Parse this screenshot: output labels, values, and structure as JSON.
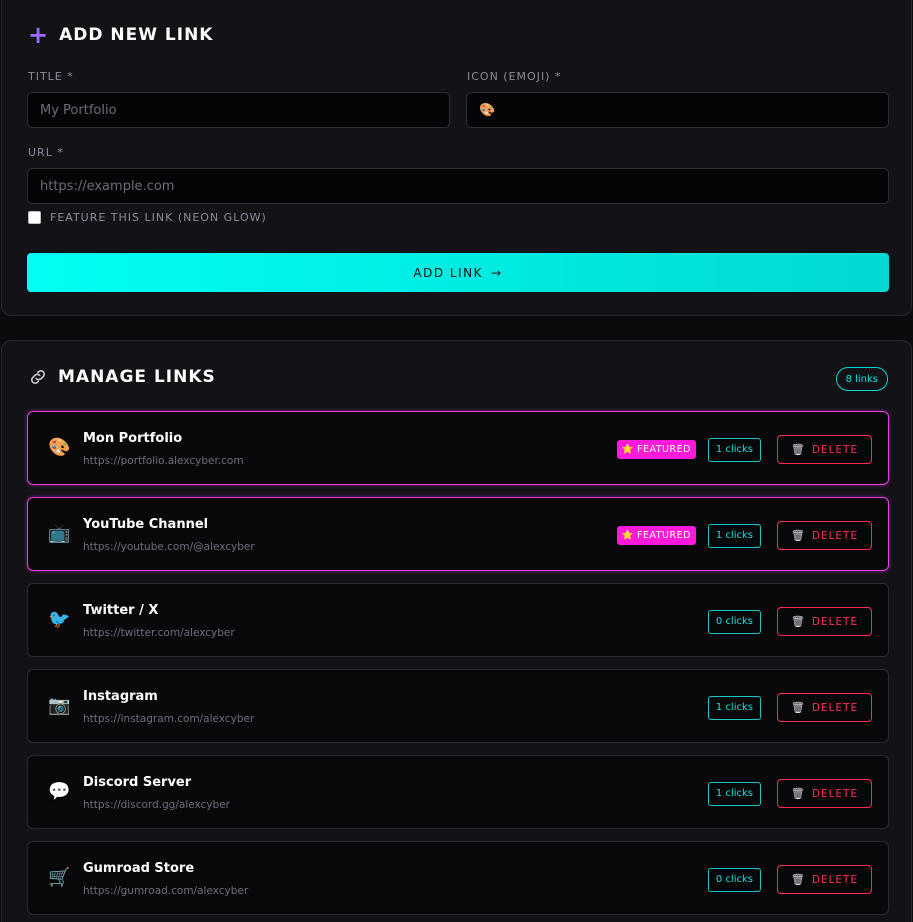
{
  "add_form": {
    "title": "ADD NEW LINK",
    "title_icon": "plus-icon",
    "title_label": "TITLE *",
    "title_placeholder": "My Portfolio",
    "icon_label": "ICON (EMOJI) *",
    "icon_value": "🎨",
    "url_label": "URL *",
    "url_placeholder": "https://example.com",
    "feature_label": "FEATURE THIS LINK (NEON GLOW)",
    "feature_checked": false,
    "submit_label": "ADD LINK",
    "submit_arrow": "→"
  },
  "manage": {
    "title": "MANAGE LINKS",
    "title_icon": "link-icon",
    "count_badge": "8 links",
    "featured_label": "FEATURED",
    "featured_star": "⭐",
    "delete_label": "DELETE",
    "delete_icon": "🗑",
    "links": [
      {
        "emoji": "🎨",
        "title": "Mon Portfolio",
        "url": "https://portfolio.alexcyber.com",
        "clicks": "1 clicks",
        "featured": true
      },
      {
        "emoji": "📺",
        "title": "YouTube Channel",
        "url": "https://youtube.com/@alexcyber",
        "clicks": "1 clicks",
        "featured": true
      },
      {
        "emoji": "🐦",
        "title": "Twitter / X",
        "url": "https://twitter.com/alexcyber",
        "clicks": "0 clicks",
        "featured": false
      },
      {
        "emoji": "📷",
        "title": "Instagram",
        "url": "https://instagram.com/alexcyber",
        "clicks": "1 clicks",
        "featured": false
      },
      {
        "emoji": "💬",
        "title": "Discord Server",
        "url": "https://discord.gg/alexcyber",
        "clicks": "1 clicks",
        "featured": false
      },
      {
        "emoji": "🛒",
        "title": "Gumroad Store",
        "url": "https://gumroad.com/alexcyber",
        "clicks": "0 clicks",
        "featured": false
      }
    ]
  },
  "colors": {
    "accent_cyan": "#00fff4",
    "accent_magenta": "#ff1ad9",
    "danger": "#ff2d55",
    "plus_icon": "#9b6cff"
  }
}
